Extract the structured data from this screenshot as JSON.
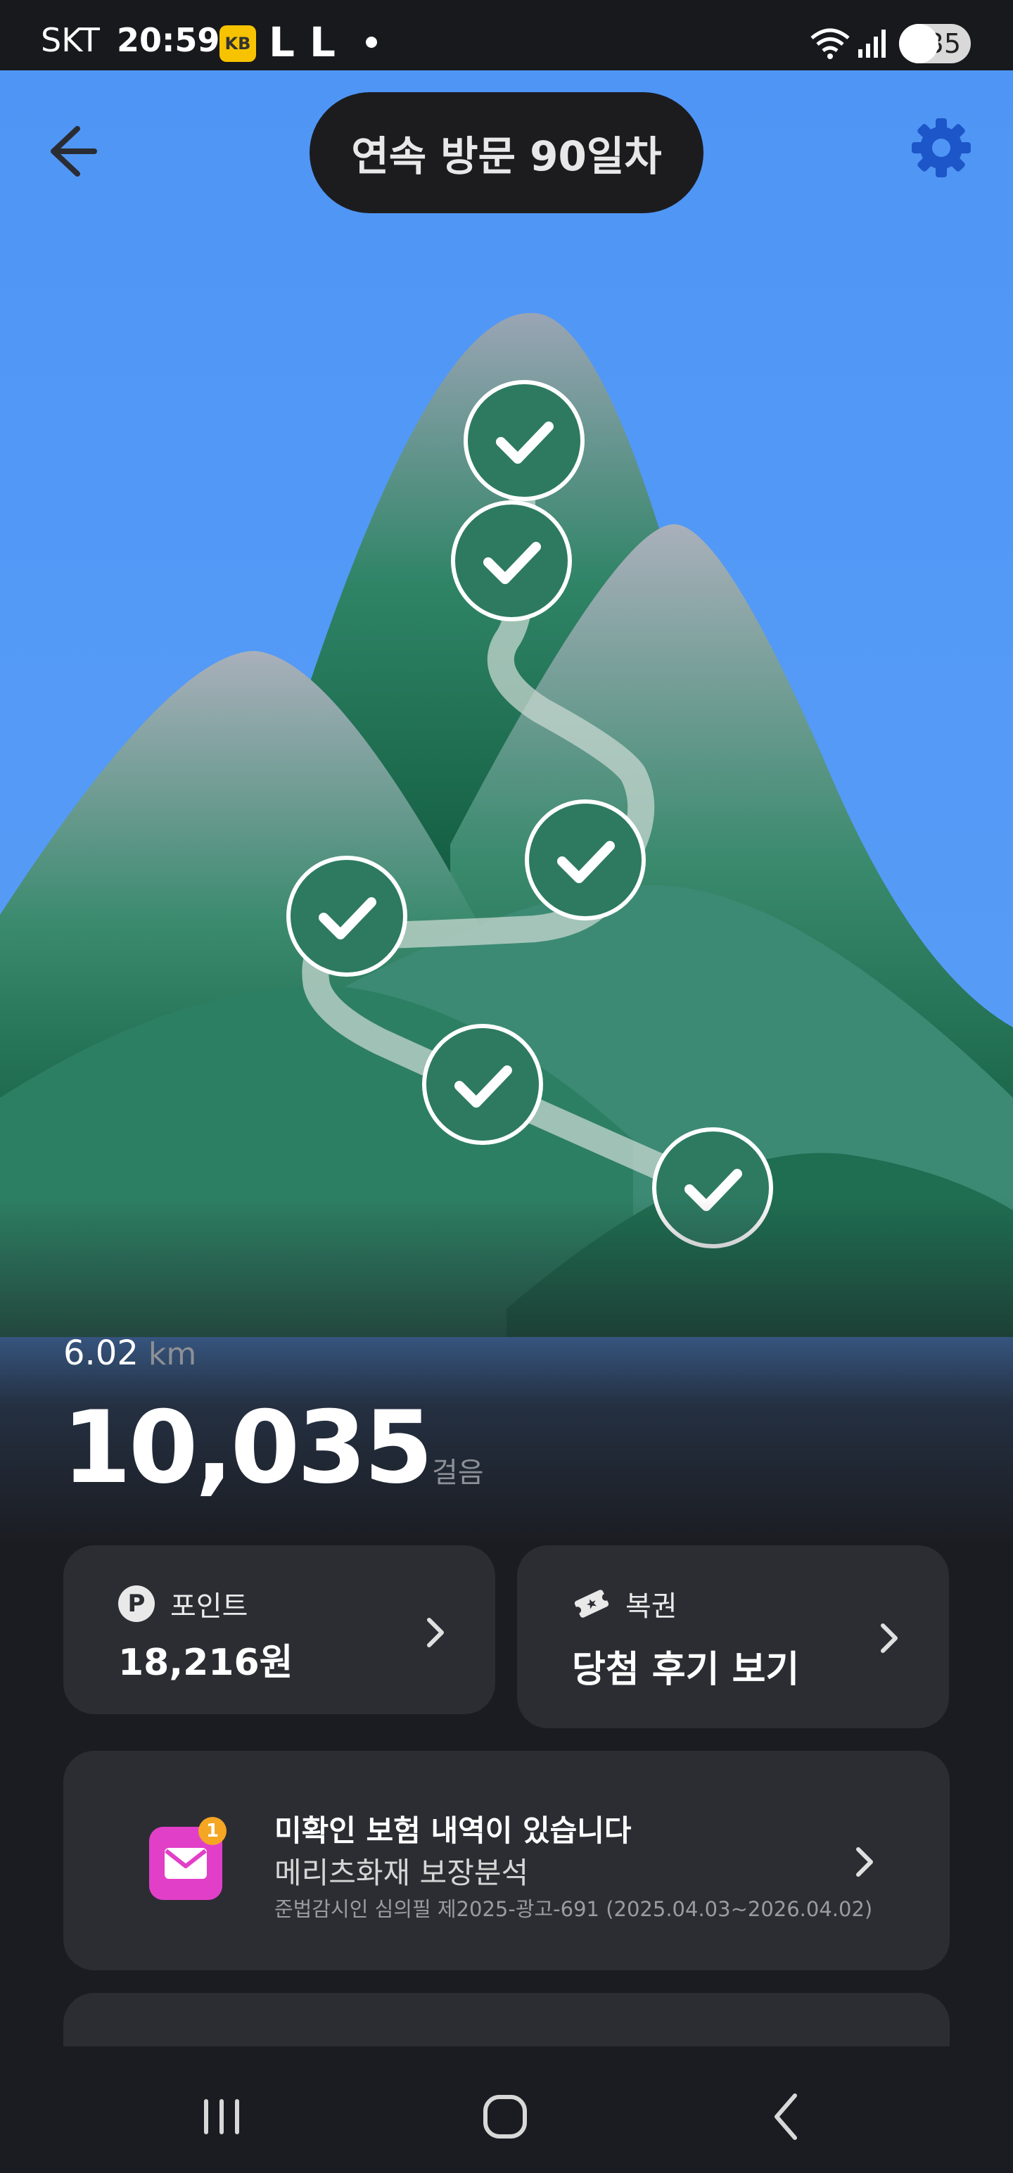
{
  "status_bar": {
    "carrier": "SKT",
    "time": "20:59",
    "kb_label": "KB",
    "l_icon_1": "L",
    "l_icon_2": "L",
    "battery": "35",
    "icons": [
      "kb-bank-icon",
      "l-icon",
      "l-icon",
      "dot-icon",
      "wifi-icon",
      "signal-icon",
      "battery-icon"
    ]
  },
  "header": {
    "title": "연속 방문 90일차",
    "icons": [
      "back-arrow-icon",
      "gear-icon"
    ],
    "accent": "#4f95f5"
  },
  "stats": {
    "distance_value": "6.02",
    "distance_unit": "km",
    "steps_value": "10,035",
    "steps_unit": "걸음"
  },
  "cards": {
    "points": {
      "label": "포인트",
      "value": "18,216원",
      "icon": "p-badge-icon"
    },
    "lotto": {
      "label": "복권",
      "value": "당첨 후기 보기",
      "icon": "ticket-icon"
    },
    "insurance": {
      "title": "미확인 보험 내역이 있습니다",
      "subtitle": "메리츠화재 보장분석",
      "note": "준법감시인 심의필 제2025-광고-691 (2025.04.03~2026.04.02)",
      "badge": "1",
      "icon": "mail-icon",
      "icon_color": "#e23fc8"
    }
  },
  "nav": {
    "icons": [
      "recent-apps-icon",
      "home-icon",
      "back-icon"
    ]
  }
}
